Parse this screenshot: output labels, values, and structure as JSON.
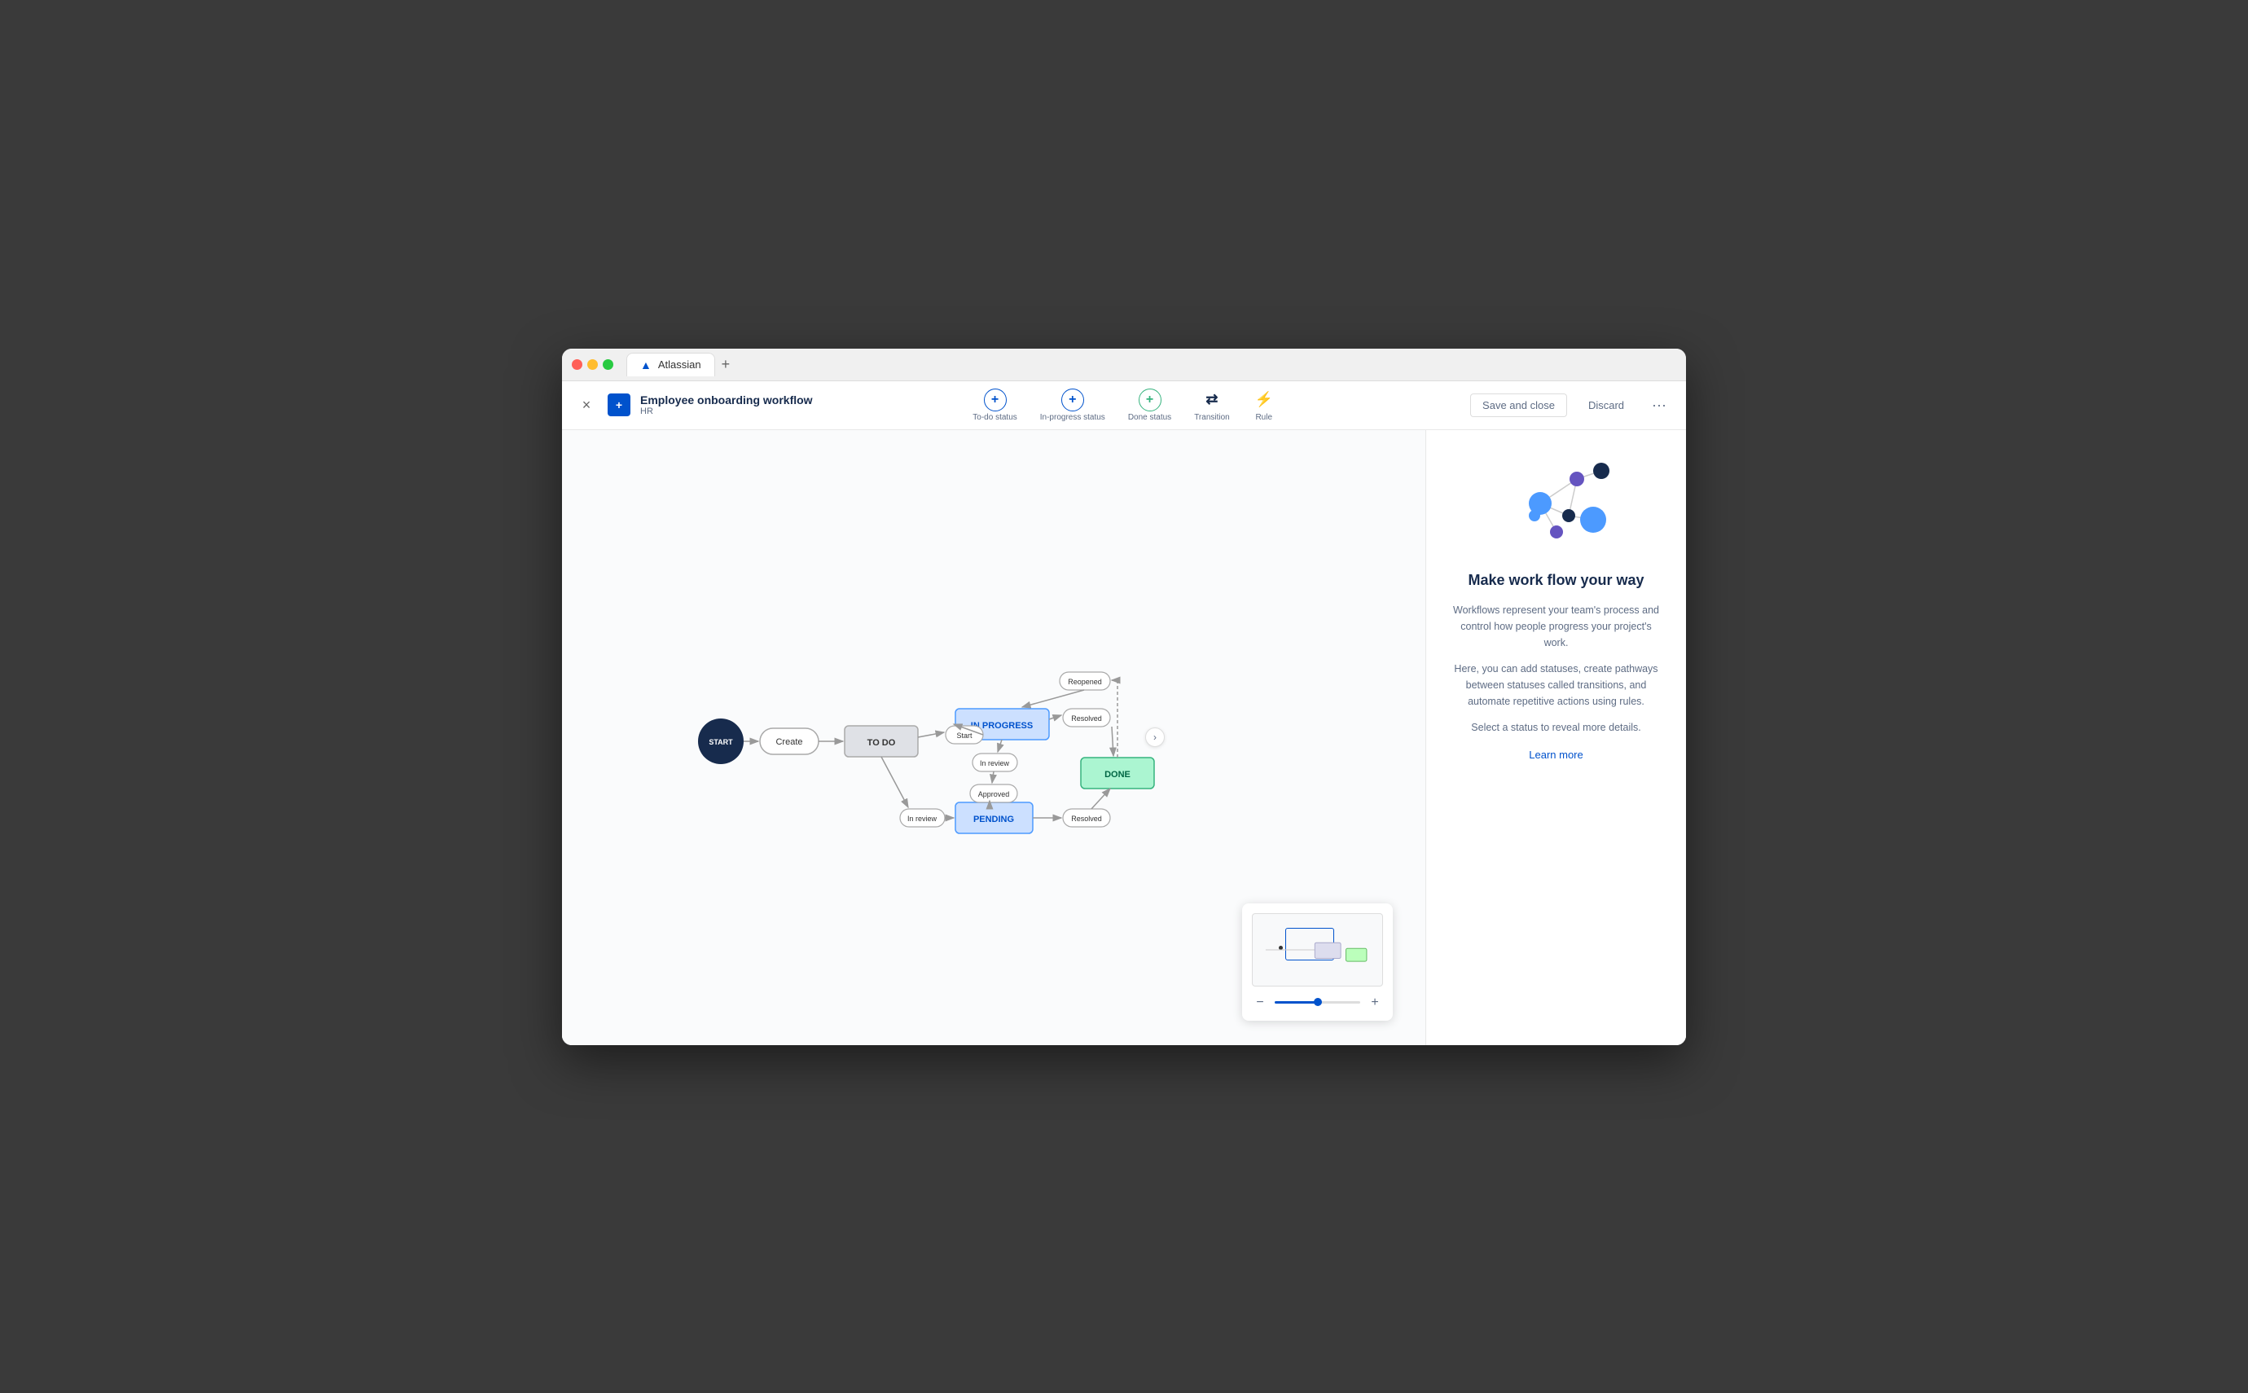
{
  "window": {
    "title": "Atlassian",
    "tab_plus": "+"
  },
  "toolbar": {
    "close_label": "×",
    "workflow_icon": "+",
    "workflow_title": "Employee onboarding workflow",
    "workflow_sub": "HR",
    "actions": [
      {
        "id": "todo-status",
        "label": "To-do status",
        "icon": "+",
        "color": "blue"
      },
      {
        "id": "inprogress-status",
        "label": "In-progress status",
        "icon": "+",
        "color": "blue"
      },
      {
        "id": "done-status",
        "label": "Done status",
        "icon": "+",
        "color": "green"
      },
      {
        "id": "transition",
        "label": "Transition",
        "icon": "⇄",
        "color": "dark"
      },
      {
        "id": "rule",
        "label": "Rule",
        "icon": "⚡",
        "color": "dark"
      }
    ],
    "save_label": "Save and close",
    "discard_label": "Discard",
    "more_label": "···"
  },
  "diagram": {
    "nodes": {
      "start": "START",
      "create": "Create",
      "todo": "TO DO",
      "inprogress": "IN PROGRESS",
      "pending": "PENDING",
      "done": "DONE",
      "start_label": "Start",
      "inreview1": "In review",
      "approved": "Approved",
      "inreview2": "In review",
      "resolved1": "Resolved",
      "resolved2": "Resolved",
      "reopened": "Reopened"
    }
  },
  "sidebar": {
    "title": "Make work flow your way",
    "desc1": "Workflows represent your team's process and control how people progress your project's work.",
    "desc2": "Here, you can add statuses, create pathways between statuses called transitions, and automate repetitive actions using rules.",
    "desc3": "Select a status to reveal more details.",
    "learn_more": "Learn more"
  },
  "minimap": {
    "zoom_minus": "−",
    "zoom_plus": "+"
  },
  "toggle": {
    "icon": "›"
  }
}
